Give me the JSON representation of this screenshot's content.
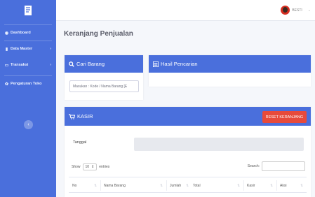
{
  "sidebar": {
    "items": [
      {
        "label": "Dashboard",
        "icon": "tachometer-icon"
      },
      {
        "label": "Data Master",
        "icon": "book-icon",
        "has_children": true
      },
      {
        "label": "Transaksi",
        "icon": "desktop-icon",
        "has_children": true
      },
      {
        "label": "Pengaturan Toko",
        "icon": "cogs-icon"
      }
    ],
    "toggle_icon": "‹"
  },
  "topbar": {
    "user_name": "BESTI"
  },
  "page": {
    "title": "Keranjang Penjualan"
  },
  "search_card": {
    "title": "Cari Barang",
    "placeholder": "Masukan : Kode / Nama Barang  [E"
  },
  "result_card": {
    "title": "Hasil Pencarian"
  },
  "kasir_card": {
    "title": "KASIR",
    "reset_label": "RESET KERANJANG",
    "date_label": "Tanggal",
    "show_label": "Show",
    "entries_value": "10",
    "entries_label": "entries",
    "search_label": "Search:",
    "columns": [
      "No",
      "Nama Barang",
      "Jumlah",
      "Total",
      "Kasir",
      "Aksi"
    ]
  },
  "colors": {
    "primary": "#4a6fdc",
    "danger": "#e74a3b",
    "background": "#f5f7fb"
  }
}
